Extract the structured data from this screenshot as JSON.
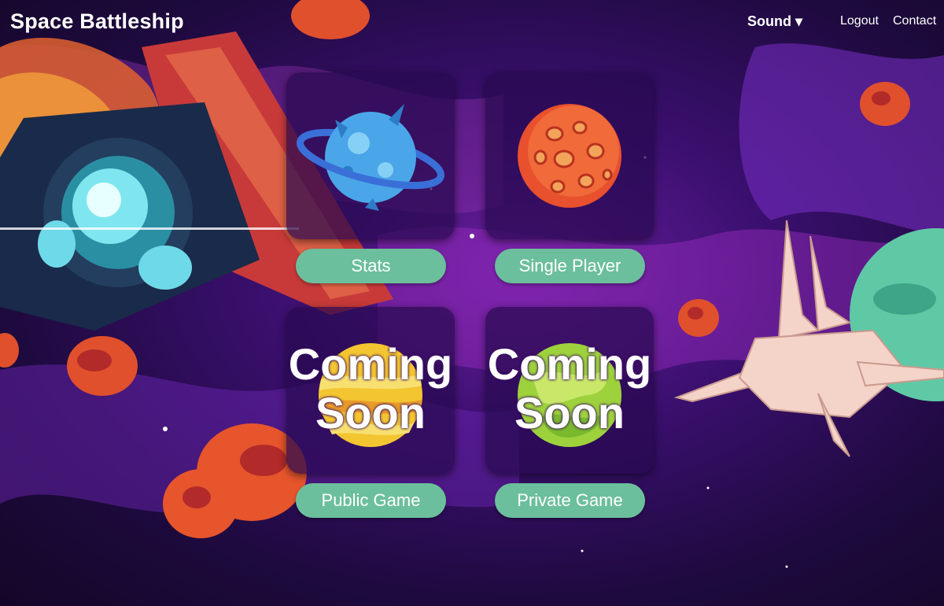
{
  "app": {
    "title": "Space Battleship"
  },
  "nav": {
    "sound_label": "Sound ▾",
    "logout_label": "Logout",
    "contact_label": "Contact"
  },
  "menu": {
    "tiles": [
      {
        "button_label": "Stats",
        "icon": "blue-spiked-ringed-planet-icon",
        "overlay": ""
      },
      {
        "button_label": "Single Player",
        "icon": "red-cratered-planet-icon",
        "overlay": ""
      },
      {
        "button_label": "Public Game",
        "icon": "yellow-striped-planet-icon",
        "overlay": "Coming Soon"
      },
      {
        "button_label": "Private Game",
        "icon": "green-planet-icon",
        "overlay": "Coming Soon"
      }
    ]
  },
  "colors": {
    "button": "#6cbf9c",
    "tile_bg": "#280a50",
    "background": "#3a0f6e"
  }
}
